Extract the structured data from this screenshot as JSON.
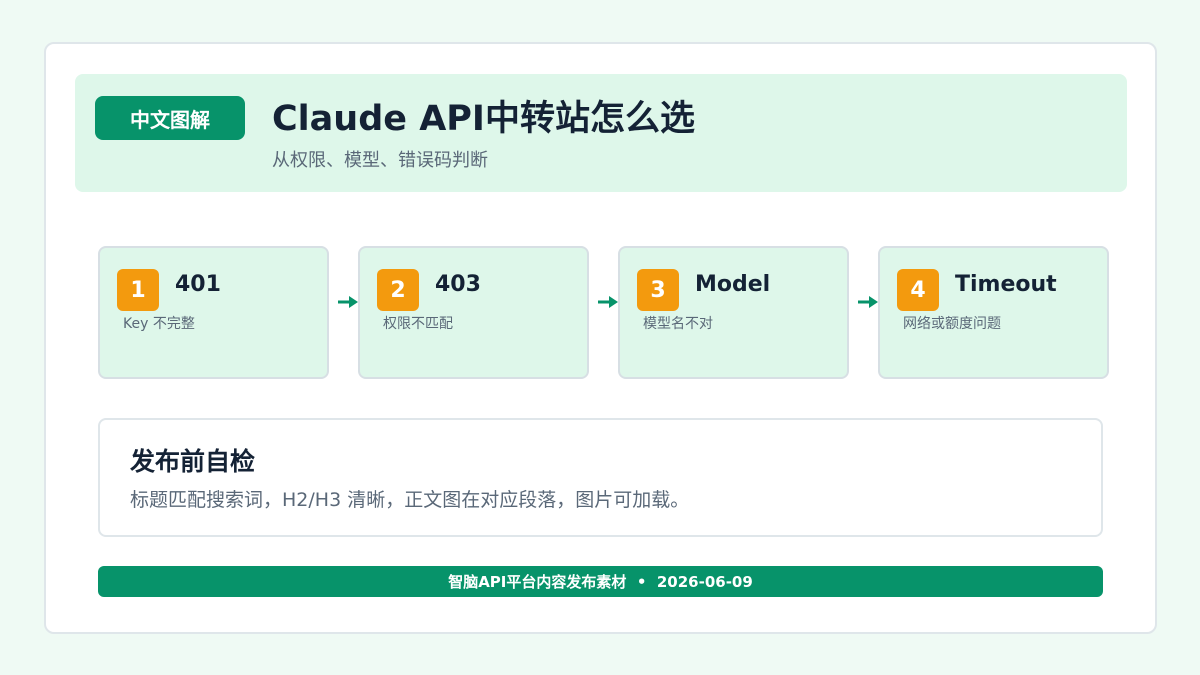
{
  "header": {
    "badge": "中文图解",
    "title": "Claude  API中转站怎么选",
    "subtitle": "从权限、模型、错误码判断"
  },
  "steps": [
    {
      "num": "1",
      "title": "401",
      "desc": "Key 不完整"
    },
    {
      "num": "2",
      "title": "403",
      "desc": "权限不匹配"
    },
    {
      "num": "3",
      "title": "Model",
      "desc": "模型名不对"
    },
    {
      "num": "4",
      "title": "Timeout",
      "desc": "网络或额度问题"
    }
  ],
  "checklist": {
    "title": "发布前自检",
    "text": "标题匹配搜索词，H2/H3 清晰，正文图在对应段落，图片可加载。"
  },
  "footer": {
    "text": "智脑API平台内容发布素材  •  2026-06-09"
  },
  "colors": {
    "accent": "#07936a",
    "step_number": "#f39a0e",
    "header_bg": "#def7ea"
  },
  "icons": {
    "arrow": "arrow-right-icon"
  }
}
